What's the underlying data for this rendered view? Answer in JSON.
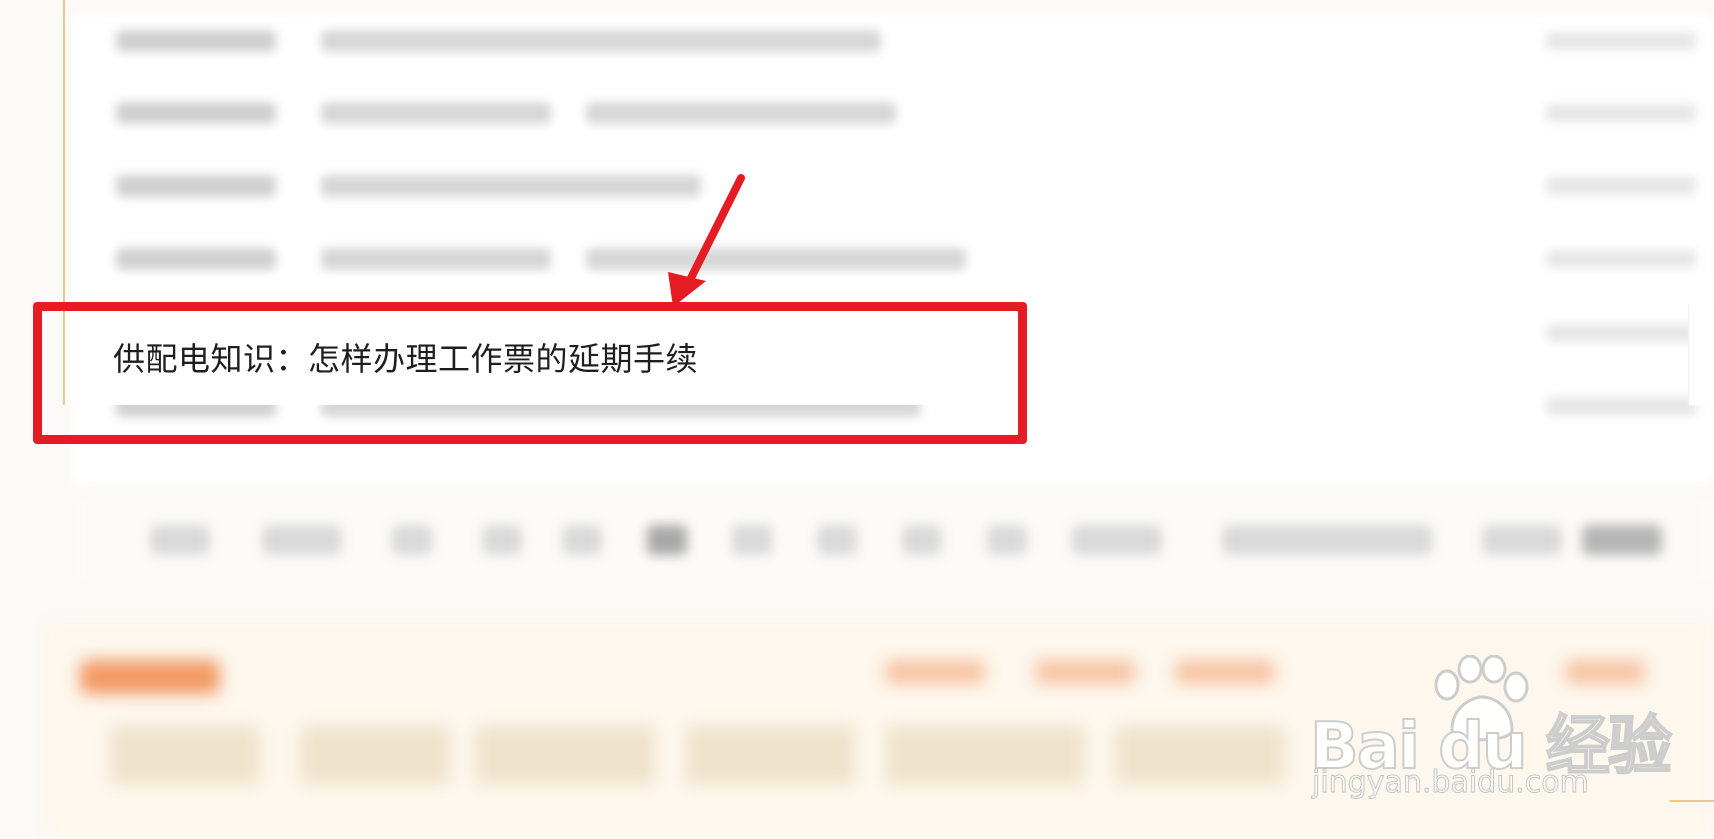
{
  "highlighted_item": {
    "title": "供配电知识：怎样办理工作票的延期手续"
  },
  "annotation": {
    "box_color": "#e51c24",
    "arrow_color": "#e51c24"
  },
  "watermark": {
    "logo_text": "Bai du 经验",
    "url": "jingyan.baidu.com"
  },
  "colors": {
    "accent_rule": "#f3c57d",
    "page_background": "#fbfaf8"
  }
}
